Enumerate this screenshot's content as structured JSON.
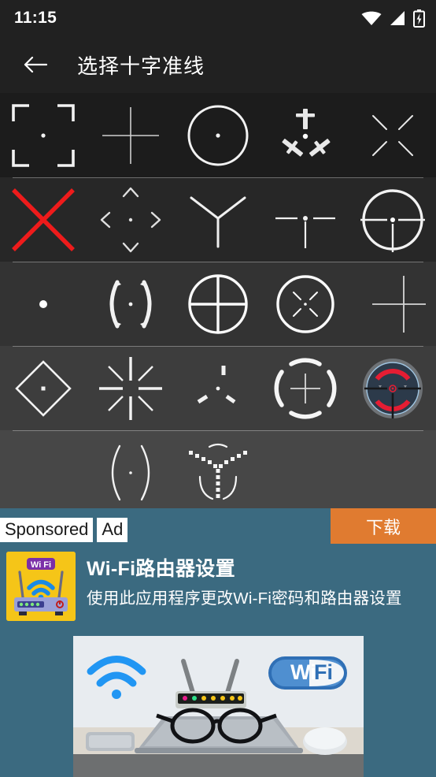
{
  "statusbar": {
    "time": "11:15",
    "icons": [
      "wifi-icon",
      "signal-icon",
      "battery-charging-icon"
    ]
  },
  "appbar": {
    "back_label": "back-arrow",
    "title": "选择十字准线"
  },
  "grid": {
    "rows": [
      {
        "row": 1,
        "items": [
          {
            "name": "crosshair-corner-brackets-dot",
            "label": "corner brackets with dot"
          },
          {
            "name": "crosshair-thin-plus",
            "label": "thin plus"
          },
          {
            "name": "crosshair-circle-dot",
            "label": "circle with dot"
          },
          {
            "name": "crosshair-three-swords",
            "label": "three swords with dot"
          },
          {
            "name": "crosshair-broken-x",
            "label": "broken X"
          }
        ]
      },
      {
        "row": 2,
        "items": [
          {
            "name": "crosshair-red-x",
            "label": "red X with dot"
          },
          {
            "name": "crosshair-four-chevrons",
            "label": "four chevrons with dot"
          },
          {
            "name": "crosshair-y-shape",
            "label": "Y shape"
          },
          {
            "name": "crosshair-t-ticks",
            "label": "horizontal ticks with stem"
          },
          {
            "name": "crosshair-ringed-scope",
            "label": "segmented ring scope"
          }
        ]
      },
      {
        "row": 3,
        "items": [
          {
            "name": "crosshair-single-dot",
            "label": "single dot"
          },
          {
            "name": "crosshair-curved-brackets-dot",
            "label": "curved brackets with dot"
          },
          {
            "name": "crosshair-circle-full-cross",
            "label": "circle with full crosshair"
          },
          {
            "name": "crosshair-circle-x-ticks",
            "label": "circle with X ticks"
          },
          {
            "name": "crosshair-offset-plus",
            "label": "offset thin plus"
          }
        ]
      },
      {
        "row": 4,
        "items": [
          {
            "name": "crosshair-diamond-dot",
            "label": "diamond with dot"
          },
          {
            "name": "crosshair-starburst",
            "label": "eight ray starburst"
          },
          {
            "name": "crosshair-three-ticks",
            "label": "three ticks with dot"
          },
          {
            "name": "crosshair-arc-brackets-plus",
            "label": "arc brackets with plus"
          },
          {
            "name": "crosshair-red-dot-sight",
            "label": "red dot sight optic"
          }
        ]
      },
      {
        "row": 5,
        "items": [
          {
            "name": "crosshair-empty-slot-1",
            "label": ""
          },
          {
            "name": "crosshair-parentheses-dot",
            "label": "parentheses with dot"
          },
          {
            "name": "crosshair-dotted-y-arcs",
            "label": "dotted Y with arcs"
          },
          {
            "name": "crosshair-empty-slot-2",
            "label": ""
          },
          {
            "name": "crosshair-empty-slot-3",
            "label": ""
          }
        ]
      }
    ]
  },
  "ad": {
    "sponsored_label": "Sponsored",
    "ad_label": "Ad",
    "download_label": "下载",
    "title": "Wi-Fi路由器设置",
    "subtitle": "使用此应用程序更改Wi-Fi密码和路由器设置",
    "icon_text": "Wi Fi",
    "hero_badge_text": "Wi Fi"
  },
  "colors": {
    "accent_orange": "#e07b30",
    "ad_background": "#3b6a80",
    "appbar": "#212121",
    "red_reticle": "#ee1b1b",
    "icon_yellow": "#f5c518"
  }
}
